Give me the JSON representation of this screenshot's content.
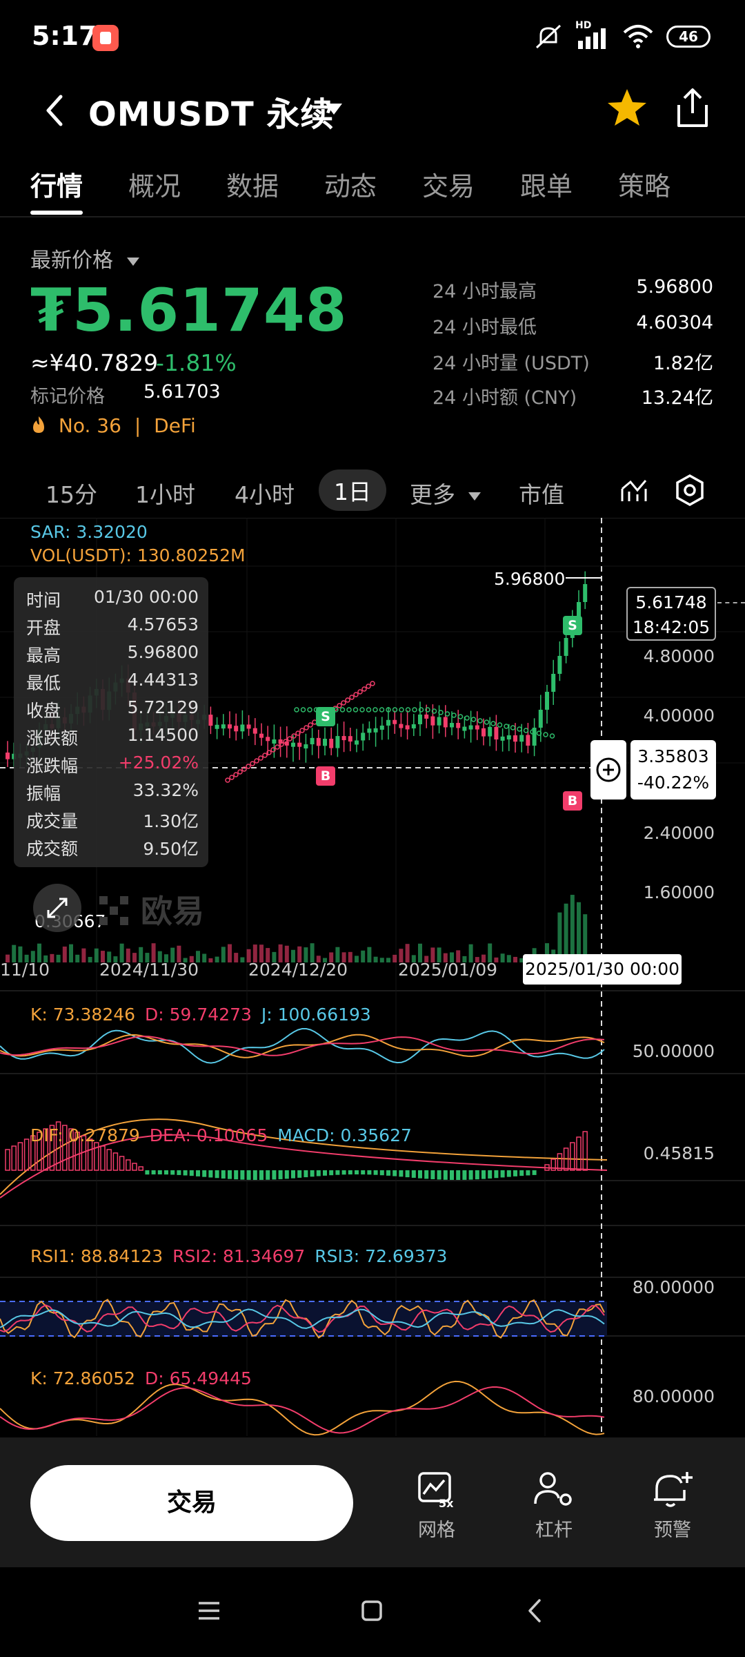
{
  "status_bar": {
    "time": "5:17",
    "network": "HD",
    "battery": "46"
  },
  "header": {
    "title": "OMUSDT 永续"
  },
  "tabs": [
    "行情",
    "概况",
    "数据",
    "动态",
    "交易",
    "跟单",
    "策略"
  ],
  "price_panel": {
    "latest_label": "最新价格",
    "price": "₮5.61748",
    "cny": "≈¥40.7829",
    "change": "-1.81%",
    "mark_label": "标记价格",
    "mark_value": "5.61703",
    "rank": "No. 36",
    "sector": "DeFi",
    "stats": [
      {
        "label": "24 小时最高",
        "value": "5.96800"
      },
      {
        "label": "24 小时最低",
        "value": "4.60304"
      },
      {
        "label": "24 小时量 (USDT)",
        "value": "1.82亿"
      },
      {
        "label": "24 小时额 (CNY)",
        "value": "13.24亿"
      }
    ]
  },
  "periods": [
    "15分",
    "1小时",
    "4小时",
    "1日",
    "更多",
    "市值"
  ],
  "chart": {
    "sar": "SAR: 3.32020",
    "vol": "VOL(USDT): 130.80252M",
    "high_label": "5.96800",
    "cur_price": "5.61748",
    "cur_time": "18:42:05",
    "y_ticks": [
      "4.80000",
      "4.00000",
      "2.40000",
      "1.60000"
    ],
    "cross_price": "3.35803",
    "cross_pct": "-40.22%",
    "low_label": "0.30667",
    "x_ticks": [
      "11/10",
      "2024/11/30",
      "2024/12/20",
      "2025/01/09"
    ],
    "x_selected": "2025/01/30 00:00",
    "watermark": "欧易",
    "tooltip": [
      {
        "k": "时间",
        "v": "01/30 00:00"
      },
      {
        "k": "开盘",
        "v": "4.57653"
      },
      {
        "k": "最高",
        "v": "5.96800"
      },
      {
        "k": "最低",
        "v": "4.44313"
      },
      {
        "k": "收盘",
        "v": "5.72129"
      },
      {
        "k": "涨跌额",
        "v": "1.14500"
      },
      {
        "k": "涨跌幅",
        "v": "+25.02%"
      },
      {
        "k": "振幅",
        "v": "33.32%"
      },
      {
        "k": "成交量",
        "v": "1.30亿"
      },
      {
        "k": "成交额",
        "v": "9.50亿"
      }
    ],
    "kdj": {
      "k": "K: 73.38246",
      "d": "D: 59.74273",
      "j": "J: 100.66193",
      "tick": "50.00000"
    },
    "macd": {
      "dif": "DIF: 0.27879",
      "dea": "DEA: 0.10065",
      "macd": "MACD: 0.35627",
      "tick": "0.45815"
    },
    "rsi": {
      "r1": "RSI1: 88.84123",
      "r2": "RSI2: 81.34697",
      "r3": "RSI3: 72.69373",
      "tick": "80.00000"
    },
    "kd2": {
      "k": "K: 72.86052",
      "d": "D: 65.49445",
      "tick": "80.00000"
    }
  },
  "bottom_bar": {
    "trade": "交易",
    "grid": "网格",
    "leverage": "杠杆",
    "alert": "预警",
    "grid_badge": "5x"
  },
  "colors": {
    "up": "#2ebd6b",
    "down": "#f23d6b",
    "accent": "#f5b800"
  }
}
